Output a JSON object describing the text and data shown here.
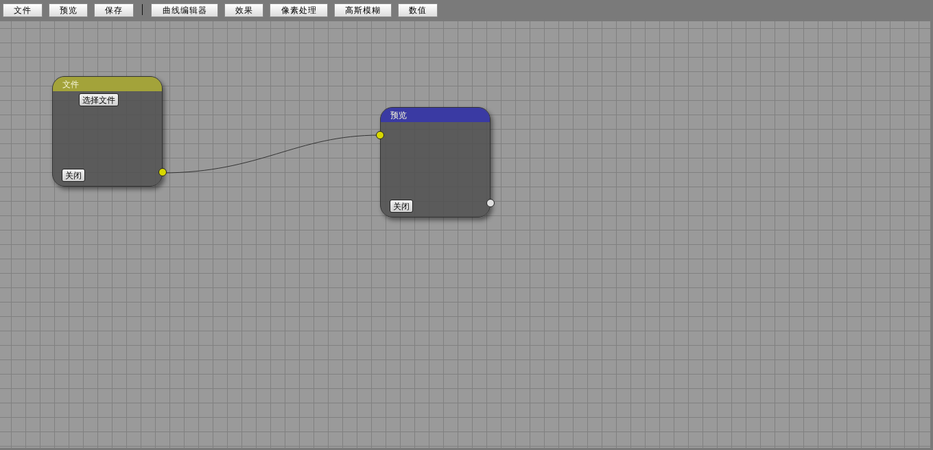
{
  "toolbar": {
    "items": [
      {
        "kind": "button",
        "label": "文件"
      },
      {
        "kind": "button",
        "label": "预览"
      },
      {
        "kind": "button",
        "label": "保存"
      },
      {
        "kind": "separator"
      },
      {
        "kind": "button",
        "label": "曲线编辑器"
      },
      {
        "kind": "button",
        "label": "效果"
      },
      {
        "kind": "button",
        "label": "像素处理"
      },
      {
        "kind": "button",
        "label": "高斯模糊"
      },
      {
        "kind": "button",
        "label": "数值"
      }
    ]
  },
  "nodes": [
    {
      "title": "文件",
      "color": "#a3a33a",
      "buttons": [
        {
          "kind": "action",
          "label": "选择文件"
        },
        {
          "kind": "close",
          "label": "关闭"
        }
      ],
      "ports": [
        {
          "kind": "output",
          "color": "#d8d800"
        }
      ]
    },
    {
      "title": "预览",
      "color": "#3a3aa3",
      "buttons": [
        {
          "kind": "close",
          "label": "关闭"
        }
      ],
      "ports": [
        {
          "kind": "input",
          "color": "#d8d800"
        },
        {
          "kind": "output",
          "color": "#e0e0e0"
        }
      ]
    }
  ]
}
